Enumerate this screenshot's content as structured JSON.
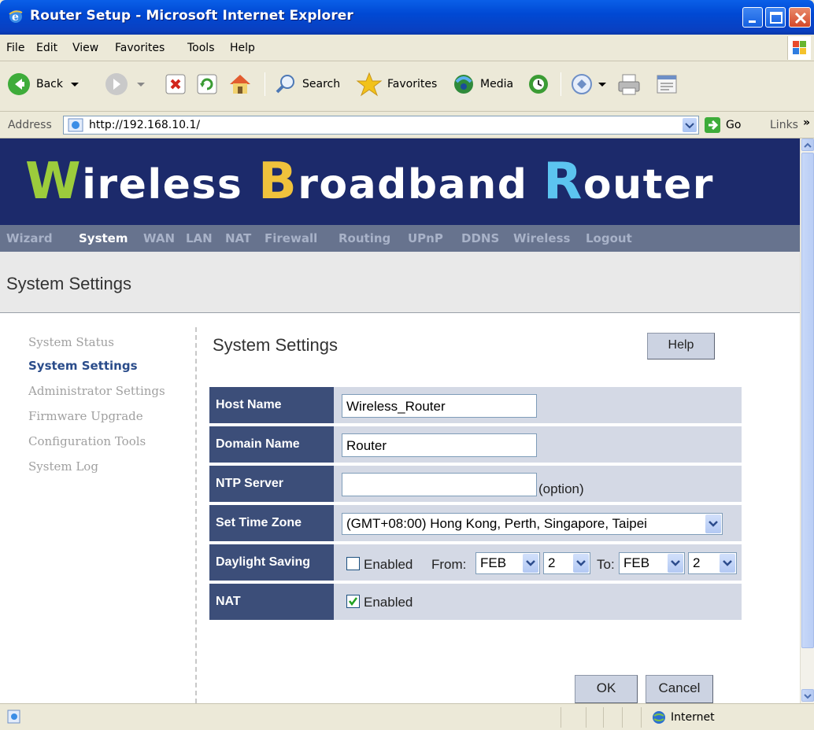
{
  "window": {
    "title": "Router Setup - Microsoft Internet Explorer"
  },
  "menu": [
    "File",
    "Edit",
    "View",
    "Favorites",
    "Tools",
    "Help"
  ],
  "toolbar": {
    "back": "Back",
    "search": "Search",
    "favorites": "Favorites",
    "media": "Media"
  },
  "address": {
    "label": "Address",
    "url": "http://192.168.10.1/",
    "go": "Go",
    "links": "Links"
  },
  "banner": {
    "words": [
      {
        "cap": "W",
        "rest": "ireless",
        "color": "#9ccc3c"
      },
      {
        "cap": "B",
        "rest": "roadband",
        "color": "#f0c23c"
      },
      {
        "cap": "R",
        "rest": "outer",
        "color": "#5cc4f0"
      }
    ]
  },
  "nav": [
    "Wizard",
    "System",
    "WAN",
    "LAN",
    "NAT",
    "Firewall",
    "Routing",
    "UPnP",
    "DDNS",
    "Wireless",
    "Logout"
  ],
  "nav_active": "System",
  "page_title": "System Settings",
  "side_menu": [
    "System Status",
    "System Settings",
    "Administrator Settings",
    "Firmware Upgrade",
    "Configuration Tools",
    "System Log"
  ],
  "side_active": "System Settings",
  "content": {
    "title": "System Settings",
    "help": "Help",
    "rows": {
      "host_name": {
        "label": "Host Name",
        "value": "Wireless_Router"
      },
      "domain_name": {
        "label": "Domain Name",
        "value": "Router"
      },
      "ntp_server": {
        "label": "NTP Server",
        "value": "",
        "hint": "(option)"
      },
      "time_zone": {
        "label": "Set Time Zone",
        "value": "(GMT+08:00) Hong Kong, Perth, Singapore, Taipei"
      },
      "daylight": {
        "label": "Daylight Saving",
        "enabled_label": "Enabled",
        "enabled": false,
        "from_label": "From:",
        "from_month": "FEB",
        "from_day": "2",
        "to_label": "To:",
        "to_month": "FEB",
        "to_day": "2"
      },
      "nat": {
        "label": "NAT",
        "enabled_label": "Enabled",
        "enabled": true
      }
    },
    "ok": "OK",
    "cancel": "Cancel"
  },
  "status": {
    "zone": "Internet"
  }
}
